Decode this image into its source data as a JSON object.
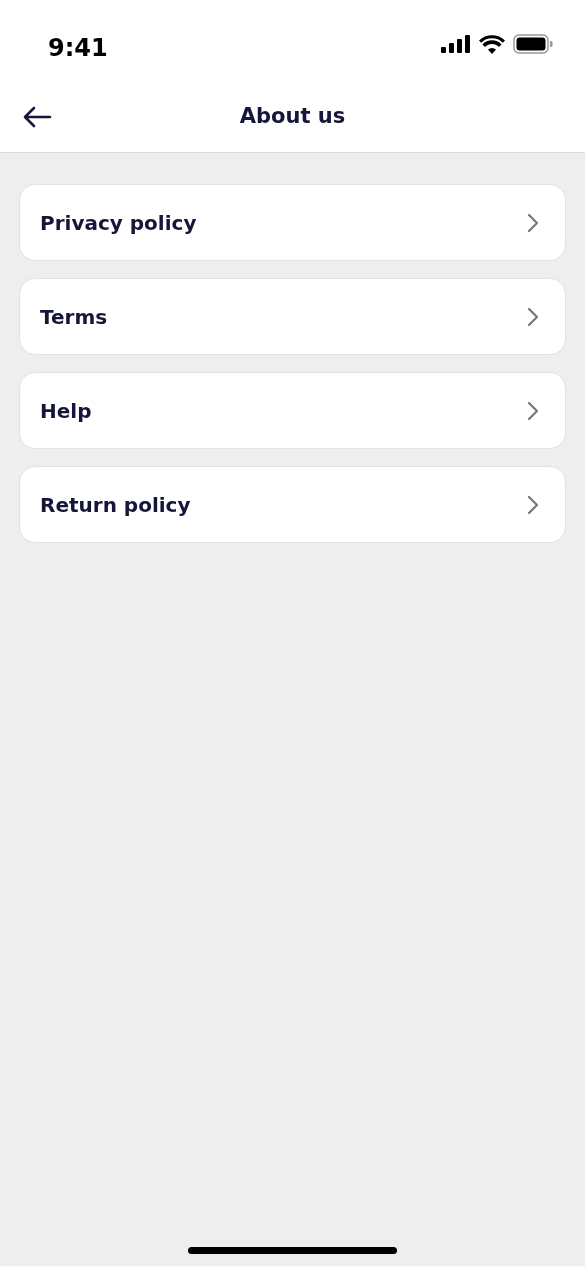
{
  "status_bar": {
    "time": "9:41"
  },
  "header": {
    "title": "About us"
  },
  "items": [
    {
      "label": "Privacy policy"
    },
    {
      "label": "Terms"
    },
    {
      "label": "Help"
    },
    {
      "label": "Return policy"
    }
  ]
}
